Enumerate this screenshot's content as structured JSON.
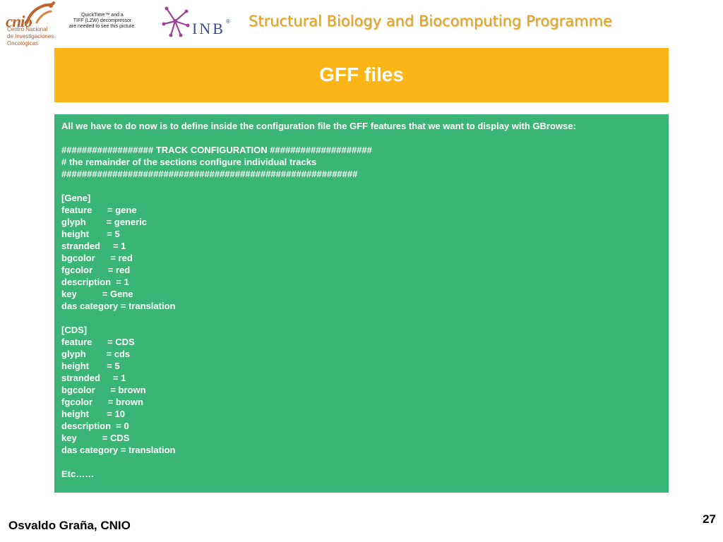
{
  "header": {
    "cnio_logo": {
      "word": "cnio",
      "subtitle_lines": [
        "Centro Nacional",
        "de Investigaciones",
        "Oncológicas"
      ]
    },
    "quicktime_placeholder": {
      "lines": [
        "QuickTime™ and a",
        "TIFF (LZW) decompressor",
        "are needed to see this picture."
      ]
    },
    "inb_logo": {
      "text": "INB",
      "registered": "®"
    },
    "programme_title": "Structural Biology and Biocomputing Programme"
  },
  "slide": {
    "title": "GFF files",
    "content_lines": [
      "All we have to do now is to define inside the configuration file the GFF features that we want to display with GBrowse:",
      "",
      "################## TRACK CONFIGURATION ####################",
      "# the remainder of the sections configure individual tracks",
      "##########################################################",
      "",
      "[Gene]",
      "feature      = gene",
      "glyph        = generic",
      "height       = 5",
      "stranded     = 1",
      "bgcolor      = red",
      "fgcolor      = red",
      "description  = 1",
      "key          = Gene",
      "das category = translation",
      "",
      "[CDS]",
      "feature      = CDS",
      "glyph        = cds",
      "height       = 5",
      "stranded     = 1",
      "bgcolor      = brown",
      "fgcolor      = brown",
      "height       = 10",
      "description  = 0",
      "key          = CDS",
      "das category = translation",
      "",
      "Etc……"
    ]
  },
  "footer": {
    "author": "Osvaldo Graña, CNIO",
    "page_number": "27"
  },
  "colors": {
    "banner": "#fbb517",
    "content_background": "#3bb575",
    "programme_title": "#e2a41c",
    "cnio_brand": "#c0622a",
    "inb_brand": "#3b4a92"
  }
}
